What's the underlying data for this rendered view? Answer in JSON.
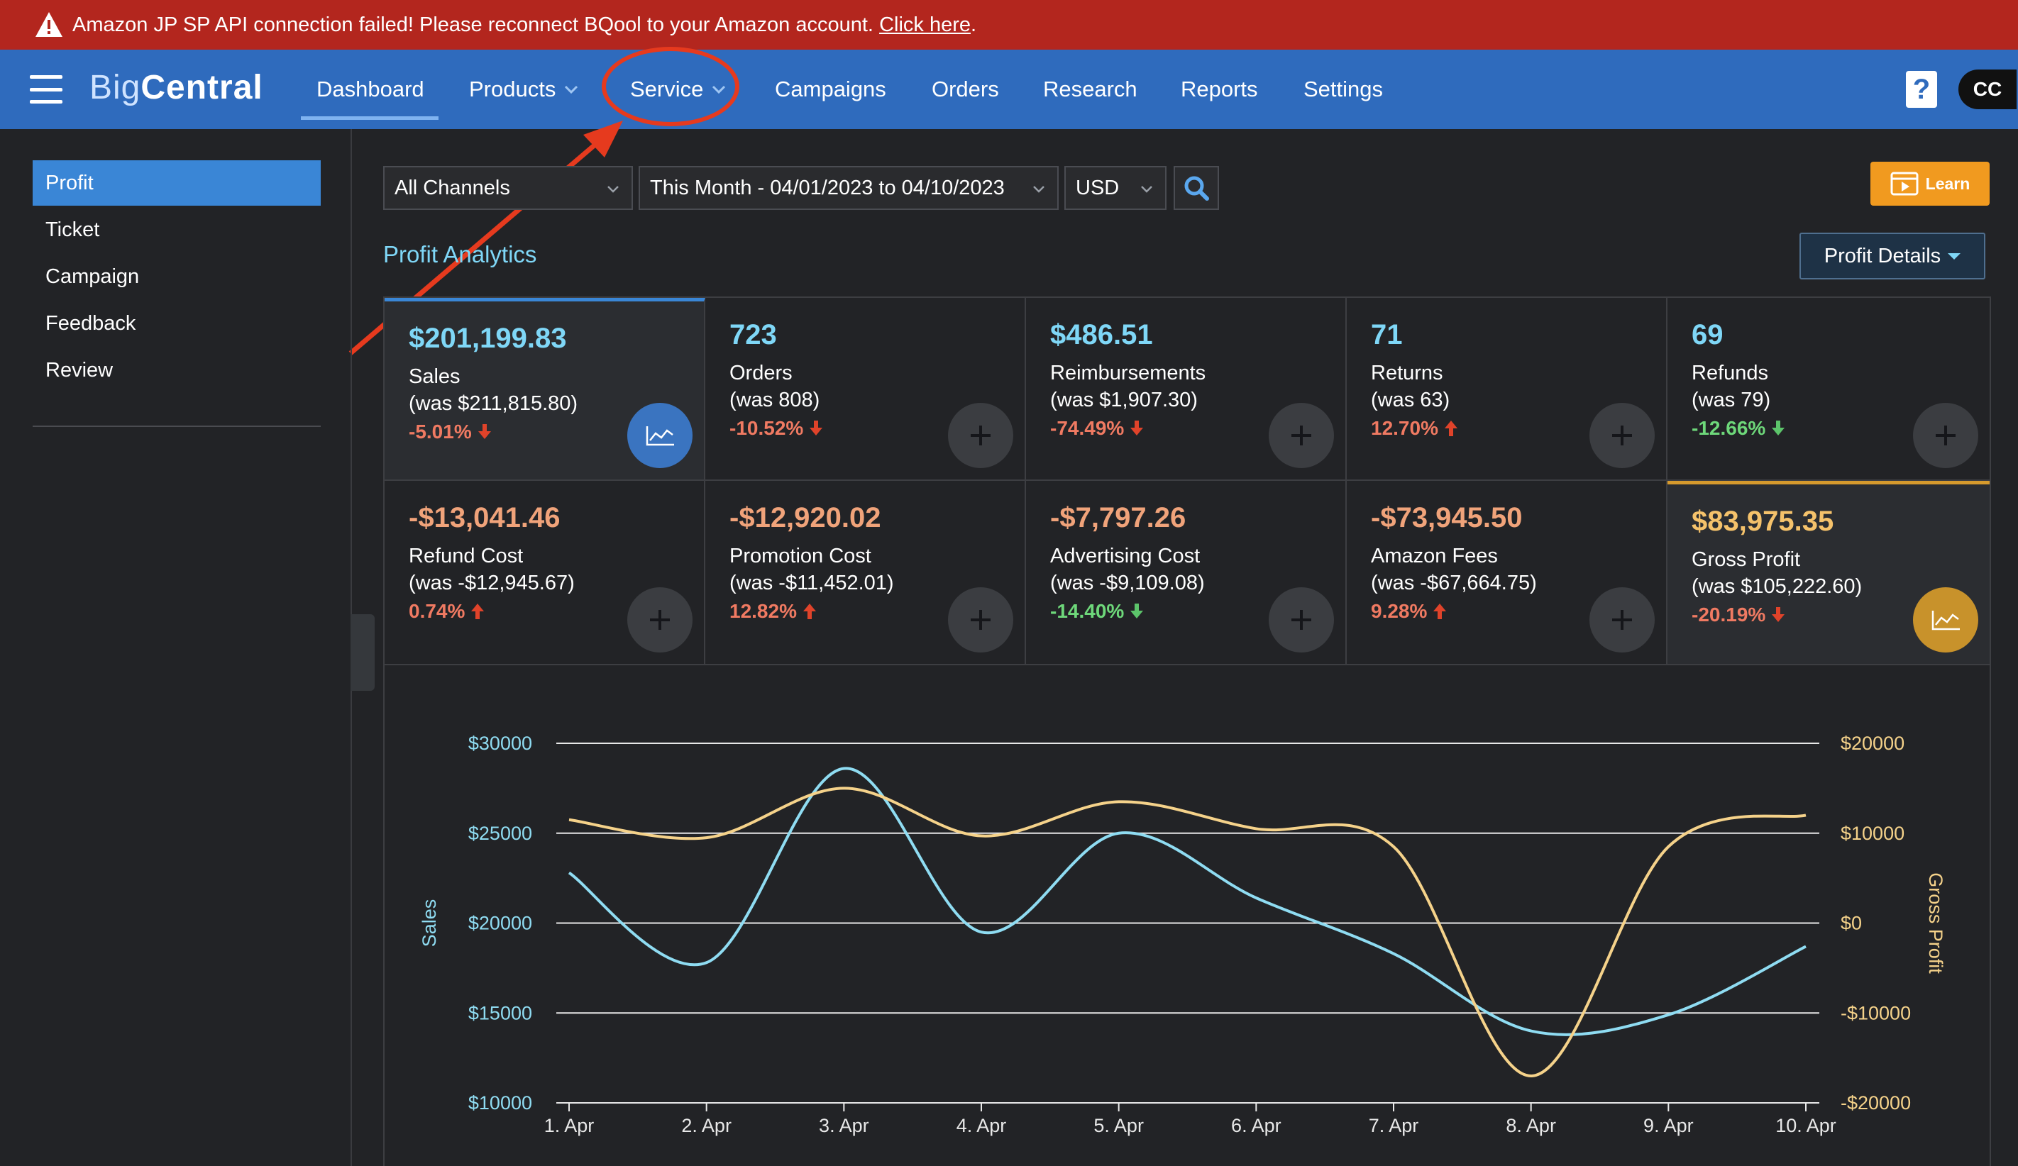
{
  "alert": {
    "message": "Amazon JP SP API connection failed! Please reconnect BQool to your Amazon account.",
    "link": "Click here",
    "period": "."
  },
  "nav": {
    "logo_big": "Big",
    "logo_central": "Central",
    "items": [
      "Dashboard",
      "Products",
      "Service",
      "Campaigns",
      "Orders",
      "Research",
      "Reports",
      "Settings"
    ],
    "help": "?",
    "avatar": "CC"
  },
  "sidebar": {
    "items": [
      "Profit",
      "Ticket",
      "Campaign",
      "Feedback",
      "Review"
    ]
  },
  "filters": {
    "channel": "All Channels",
    "date_range": "This Month - 04/01/2023 to 04/10/2023",
    "currency": "USD"
  },
  "learn_button": "Learn",
  "section_title": "Profit Analytics",
  "profit_details_button": "Profit Details",
  "metrics": [
    {
      "value": "$201,199.83",
      "label": "Sales",
      "was": "(was $211,815.80)",
      "pct": "-5.01%",
      "dir": "down"
    },
    {
      "value": "723",
      "label": "Orders",
      "was": "(was 808)",
      "pct": "-10.52%",
      "dir": "down"
    },
    {
      "value": "$486.51",
      "label": "Reimbursements",
      "was": "(was $1,907.30)",
      "pct": "-74.49%",
      "dir": "down"
    },
    {
      "value": "71",
      "label": "Returns",
      "was": "(was 63)",
      "pct": "12.70%",
      "dir": "up"
    },
    {
      "value": "69",
      "label": "Refunds",
      "was": "(was 79)",
      "pct": "-12.66%",
      "dir": "down"
    },
    {
      "value": "-$13,041.46",
      "label": "Refund Cost",
      "was": "(was -$12,945.67)",
      "pct": "0.74%",
      "dir": "up"
    },
    {
      "value": "-$12,920.02",
      "label": "Promotion Cost",
      "was": "(was -$11,452.01)",
      "pct": "12.82%",
      "dir": "up"
    },
    {
      "value": "-$7,797.26",
      "label": "Advertising Cost",
      "was": "(was -$9,109.08)",
      "pct": "-14.40%",
      "dir": "down"
    },
    {
      "value": "-$73,945.50",
      "label": "Amazon Fees",
      "was": "(was -$67,664.75)",
      "pct": "9.28%",
      "dir": "up"
    },
    {
      "value": "$83,975.35",
      "label": "Gross Profit",
      "was": "(was $105,222.60)",
      "pct": "-20.19%",
      "dir": "down"
    }
  ],
  "colors": {
    "sales": "#8fdcf2",
    "gross_profit": "#f5d28a",
    "red": "#f07a62",
    "green": "#6ed87a",
    "accent": "#3a86d6"
  },
  "chart_data": {
    "type": "line",
    "categories": [
      "1. Apr",
      "2. Apr",
      "3. Apr",
      "4. Apr",
      "5. Apr",
      "6. Apr",
      "7. Apr",
      "8. Apr",
      "9. Apr",
      "10. Apr"
    ],
    "y_left": {
      "label": "Sales",
      "ticks": [
        "$30000",
        "$25000",
        "$20000",
        "$15000",
        "$10000"
      ],
      "range": [
        10000,
        30000
      ]
    },
    "y_right": {
      "label": "Gross Profit",
      "ticks": [
        "$20000",
        "$10000",
        "$0",
        "-$10000",
        "-$20000"
      ],
      "range": [
        -20000,
        20000
      ]
    },
    "series": [
      {
        "name": "Sales",
        "axis": "left",
        "values": [
          22800,
          17800,
          28600,
          19500,
          25000,
          21400,
          18300,
          14000,
          14900,
          18700
        ]
      },
      {
        "name": "Gross Profit",
        "axis": "right",
        "values": [
          11500,
          9500,
          15000,
          9700,
          13500,
          10500,
          8500,
          -17000,
          8500,
          12000
        ]
      }
    ]
  }
}
